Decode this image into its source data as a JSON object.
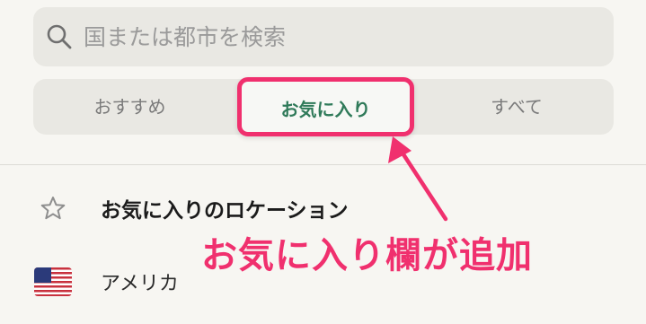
{
  "search": {
    "placeholder": "国または都市を検索",
    "icon": "search-icon"
  },
  "tabs": [
    {
      "label": "おすすめ",
      "selected": false
    },
    {
      "label": "お気に入り",
      "selected": true
    },
    {
      "label": "すべて",
      "selected": false
    }
  ],
  "favorites_section": {
    "label": "お気に入りのロケーション",
    "icon": "star-outline-icon"
  },
  "countries": [
    {
      "label": "アメリカ",
      "icon": "us-flag-icon"
    }
  ],
  "annotation": {
    "text": "お気に入り欄が追加",
    "color": "#f0306e"
  },
  "colors": {
    "accent_text": "#2f7a59",
    "highlight": "#f0306e",
    "background": "#f7f6f2",
    "control_bg": "#e9e8e3"
  }
}
